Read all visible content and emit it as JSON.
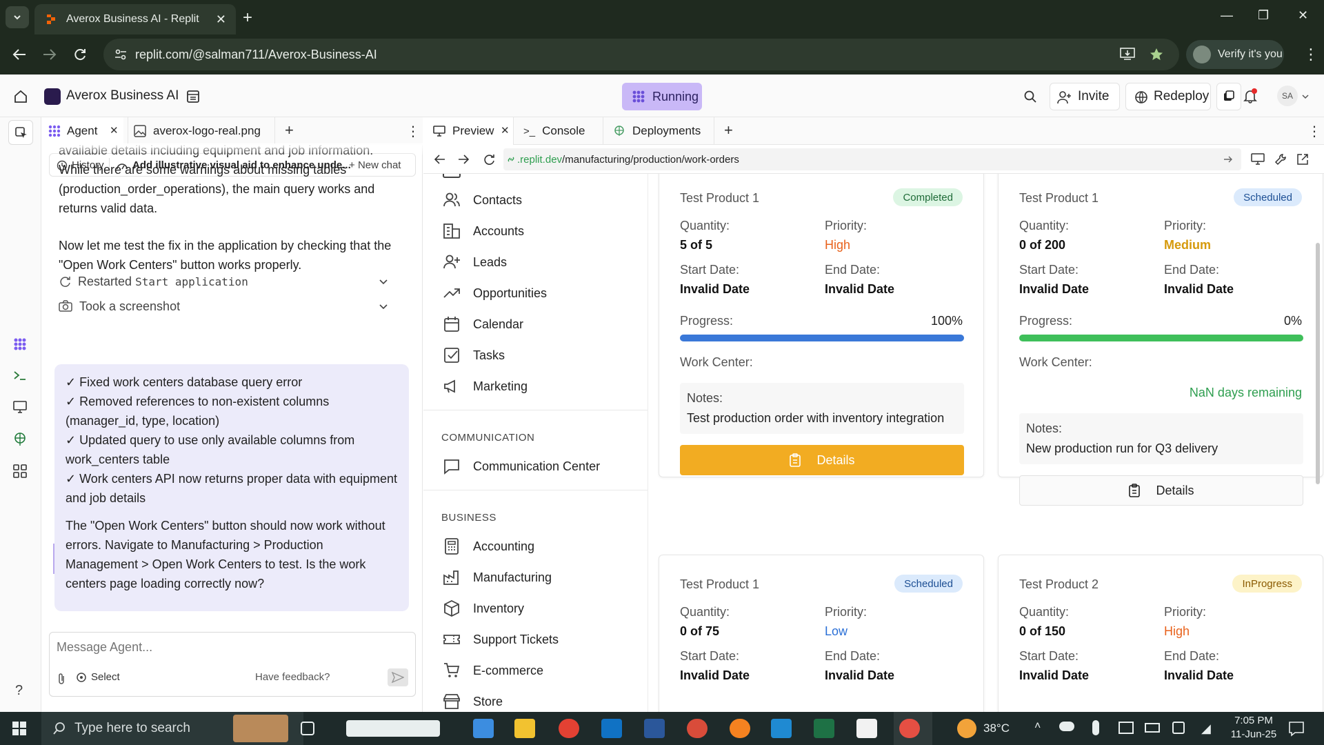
{
  "browser": {
    "tab_title": "Averox Business AI - Replit",
    "url": "replit.com/@salman711/Averox-Business-AI",
    "verify_label": "Verify it's you"
  },
  "app_header": {
    "project_name": "Averox Business AI",
    "status": "Running",
    "invite_label": "Invite",
    "redeploy_label": "Redeploy",
    "avatar_initials": "SA"
  },
  "agent_panel": {
    "tabs": [
      {
        "label": "Agent"
      },
      {
        "label": "averox-logo-real.png"
      }
    ],
    "history_label": "History",
    "thread_title": "Add illustrative visual aid to enhance unde...",
    "new_chat_label": "New chat",
    "message_top": "available details including equipment and job information. While there are some warnings about missing tables (production_order_operations), the main query works and returns valid data.",
    "message_2": "Now let me test the fix in the application by checking that the \"Open Work Centers\" button works properly.",
    "step_1_prefix": "Restarted",
    "step_1_code": "Start application",
    "step_2": "Took a screenshot",
    "summary_items": [
      "✓ Fixed work centers database query error",
      "✓ Removed references to non-existent columns (manager_id, type, location)",
      "✓ Updated query to use only available columns from work_centers table",
      "✓ Work centers API now returns proper data with equipment and job details"
    ],
    "summary_outro": "The \"Open Work Centers\" button should now work without errors. Navigate to Manufacturing > Production Management > Open Work Centers to test. Is the work centers page loading correctly now?",
    "input_placeholder": "Message Agent...",
    "select_label": "Select",
    "feedback_label": "Have feedback?"
  },
  "preview_panel": {
    "tabs": [
      {
        "label": "Preview"
      },
      {
        "label": "Console"
      },
      {
        "label": "Deployments"
      }
    ],
    "url_domain": ".replit.dev",
    "url_path": "/manufacturing/production/work-orders"
  },
  "sidebar": {
    "items": [
      {
        "label": "Contacts",
        "icon": "contacts-icon"
      },
      {
        "label": "Accounts",
        "icon": "accounts-icon"
      },
      {
        "label": "Leads",
        "icon": "leads-icon"
      },
      {
        "label": "Opportunities",
        "icon": "trend-icon"
      },
      {
        "label": "Calendar",
        "icon": "calendar-icon"
      },
      {
        "label": "Tasks",
        "icon": "tasks-icon"
      },
      {
        "label": "Marketing",
        "icon": "megaphone-icon"
      }
    ],
    "communication_header": "COMMUNICATION",
    "communication_items": [
      {
        "label": "Communication Center",
        "icon": "message-icon"
      }
    ],
    "business_header": "BUSINESS",
    "business_items": [
      {
        "label": "Accounting",
        "icon": "calculator-icon"
      },
      {
        "label": "Manufacturing",
        "icon": "factory-icon"
      },
      {
        "label": "Inventory",
        "icon": "box-icon"
      },
      {
        "label": "Support Tickets",
        "icon": "ticket-icon"
      },
      {
        "label": "E-commerce",
        "icon": "cart-icon"
      },
      {
        "label": "Store",
        "icon": "store-icon"
      }
    ]
  },
  "work_orders": {
    "labels": {
      "quantity": "Quantity:",
      "priority": "Priority:",
      "start_date": "Start Date:",
      "end_date": "End Date:",
      "progress": "Progress:",
      "work_center": "Work Center:",
      "notes": "Notes:",
      "details": "Details"
    },
    "cards": [
      {
        "product": "Test Product 1",
        "status": "Completed",
        "quantity": "5 of 5",
        "priority": "High",
        "start_date": "Invalid Date",
        "end_date": "Invalid Date",
        "progress_label": "100%",
        "progress": 1.0,
        "notes": "Test production order with inventory integration",
        "remaining": ""
      },
      {
        "product": "Test Product 1",
        "status": "Scheduled",
        "quantity": "0 of 200",
        "priority": "Medium",
        "start_date": "Invalid Date",
        "end_date": "Invalid Date",
        "progress_label": "0%",
        "progress": 1.0,
        "notes": "New production run for Q3 delivery",
        "remaining": "NaN days remaining"
      },
      {
        "product": "Test Product 1",
        "status": "Scheduled",
        "quantity": "0 of 75",
        "priority": "Low",
        "start_date": "Invalid Date",
        "end_date": "Invalid Date"
      },
      {
        "product": "Test Product 2",
        "status": "InProgress",
        "quantity": "0 of 150",
        "priority": "High",
        "start_date": "Invalid Date",
        "end_date": "Invalid Date"
      }
    ]
  },
  "taskbar": {
    "search_placeholder": "Type here to search",
    "temperature": "38°C",
    "time": "7:05 PM",
    "date": "11-Jun-25"
  },
  "colors": {
    "running_bg": "#c9b8f7",
    "high": "#e8621c",
    "medium": "#d69a0c",
    "low": "#2a6fd6",
    "progress_blue": "#3a78d8",
    "progress_green": "#3fbf5a",
    "details_orange": "#f2ac22",
    "remaining_green": "#2e9e4f"
  }
}
